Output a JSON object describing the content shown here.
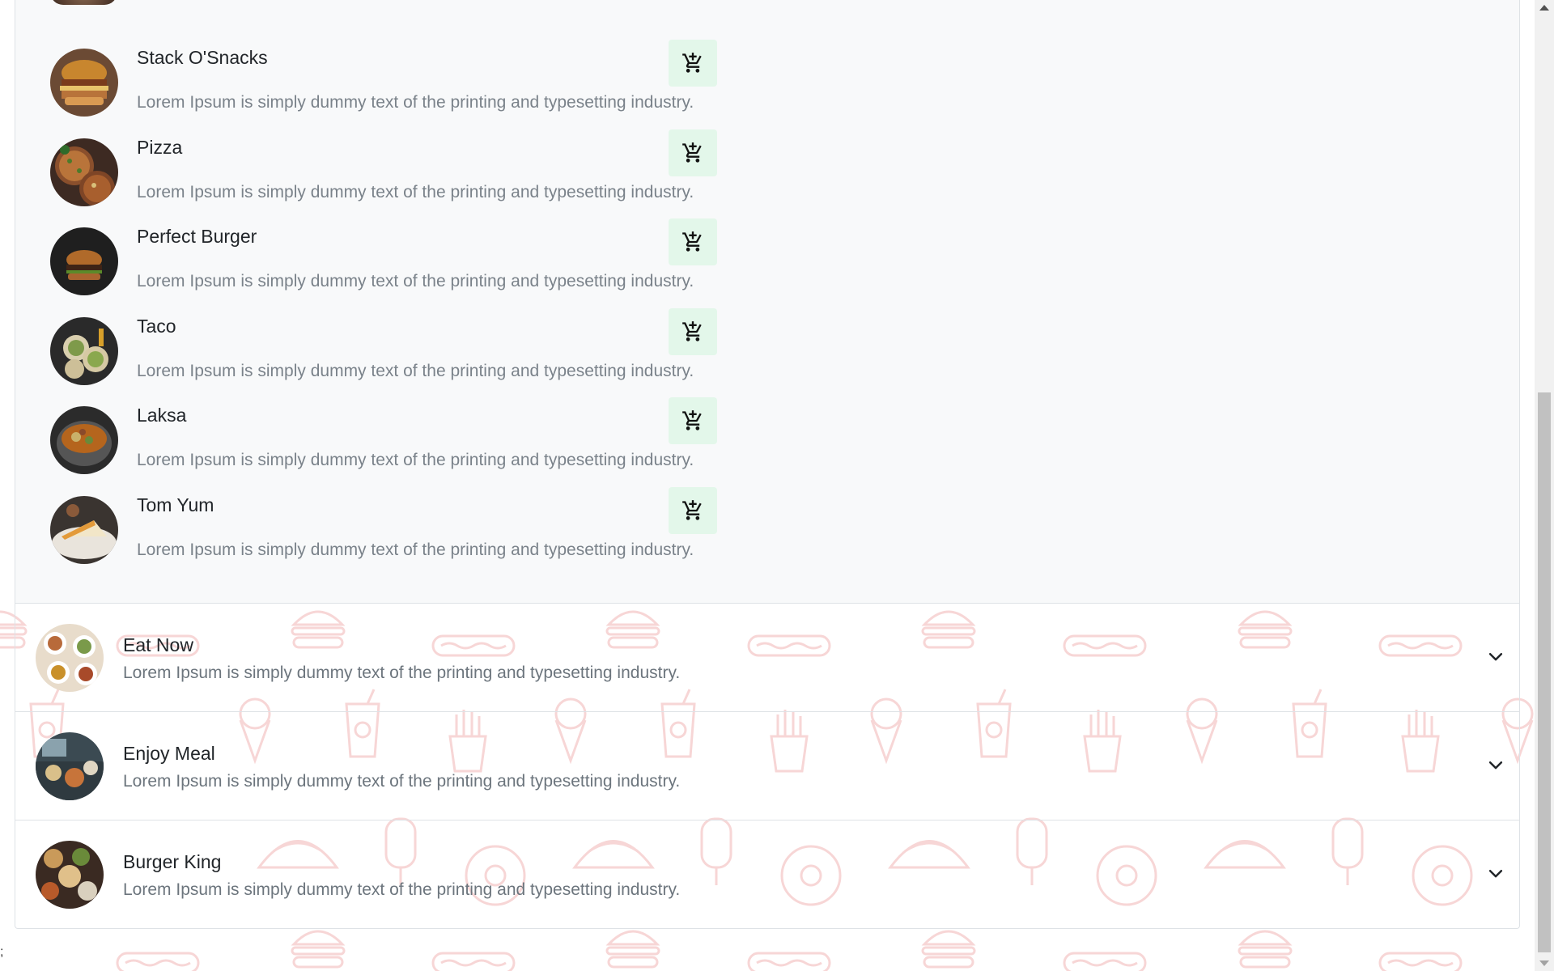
{
  "menu_items": [
    {
      "name": "Stack O'Snacks",
      "description": "Lorem Ipsum is simply dummy text of the printing and typesetting industry.",
      "icon": "add-to-cart-icon"
    },
    {
      "name": "Pizza",
      "description": "Lorem Ipsum is simply dummy text of the printing and typesetting industry.",
      "icon": "add-to-cart-icon"
    },
    {
      "name": "Perfect Burger",
      "description": "Lorem Ipsum is simply dummy text of the printing and typesetting industry.",
      "icon": "add-to-cart-icon"
    },
    {
      "name": "Taco",
      "description": "Lorem Ipsum is simply dummy text of the printing and typesetting industry.",
      "icon": "add-to-cart-icon"
    },
    {
      "name": "Laksa",
      "description": "Lorem Ipsum is simply dummy text of the printing and typesetting industry.",
      "icon": "add-to-cart-icon"
    },
    {
      "name": "Tom Yum",
      "description": "Lorem Ipsum is simply dummy text of the printing and typesetting industry.",
      "icon": "add-to-cart-icon"
    }
  ],
  "restaurants": [
    {
      "name": "Eat Now",
      "description": "Lorem Ipsum is simply dummy text of the printing and typesetting industry.",
      "icon": "chevron-down-icon"
    },
    {
      "name": "Enjoy Meal",
      "description": "Lorem Ipsum is simply dummy text of the printing and typesetting industry.",
      "icon": "chevron-down-icon"
    },
    {
      "name": "Burger King",
      "description": "Lorem Ipsum is simply dummy text of the printing and typesetting industry.",
      "icon": "chevron-down-icon"
    }
  ],
  "stray_text": ";",
  "colors": {
    "expanded_bg": "#f8f9fa",
    "cart_button_bg": "#e3f7ea",
    "pattern_stroke": "#f7d4d4",
    "description_text": "#6c757d"
  }
}
